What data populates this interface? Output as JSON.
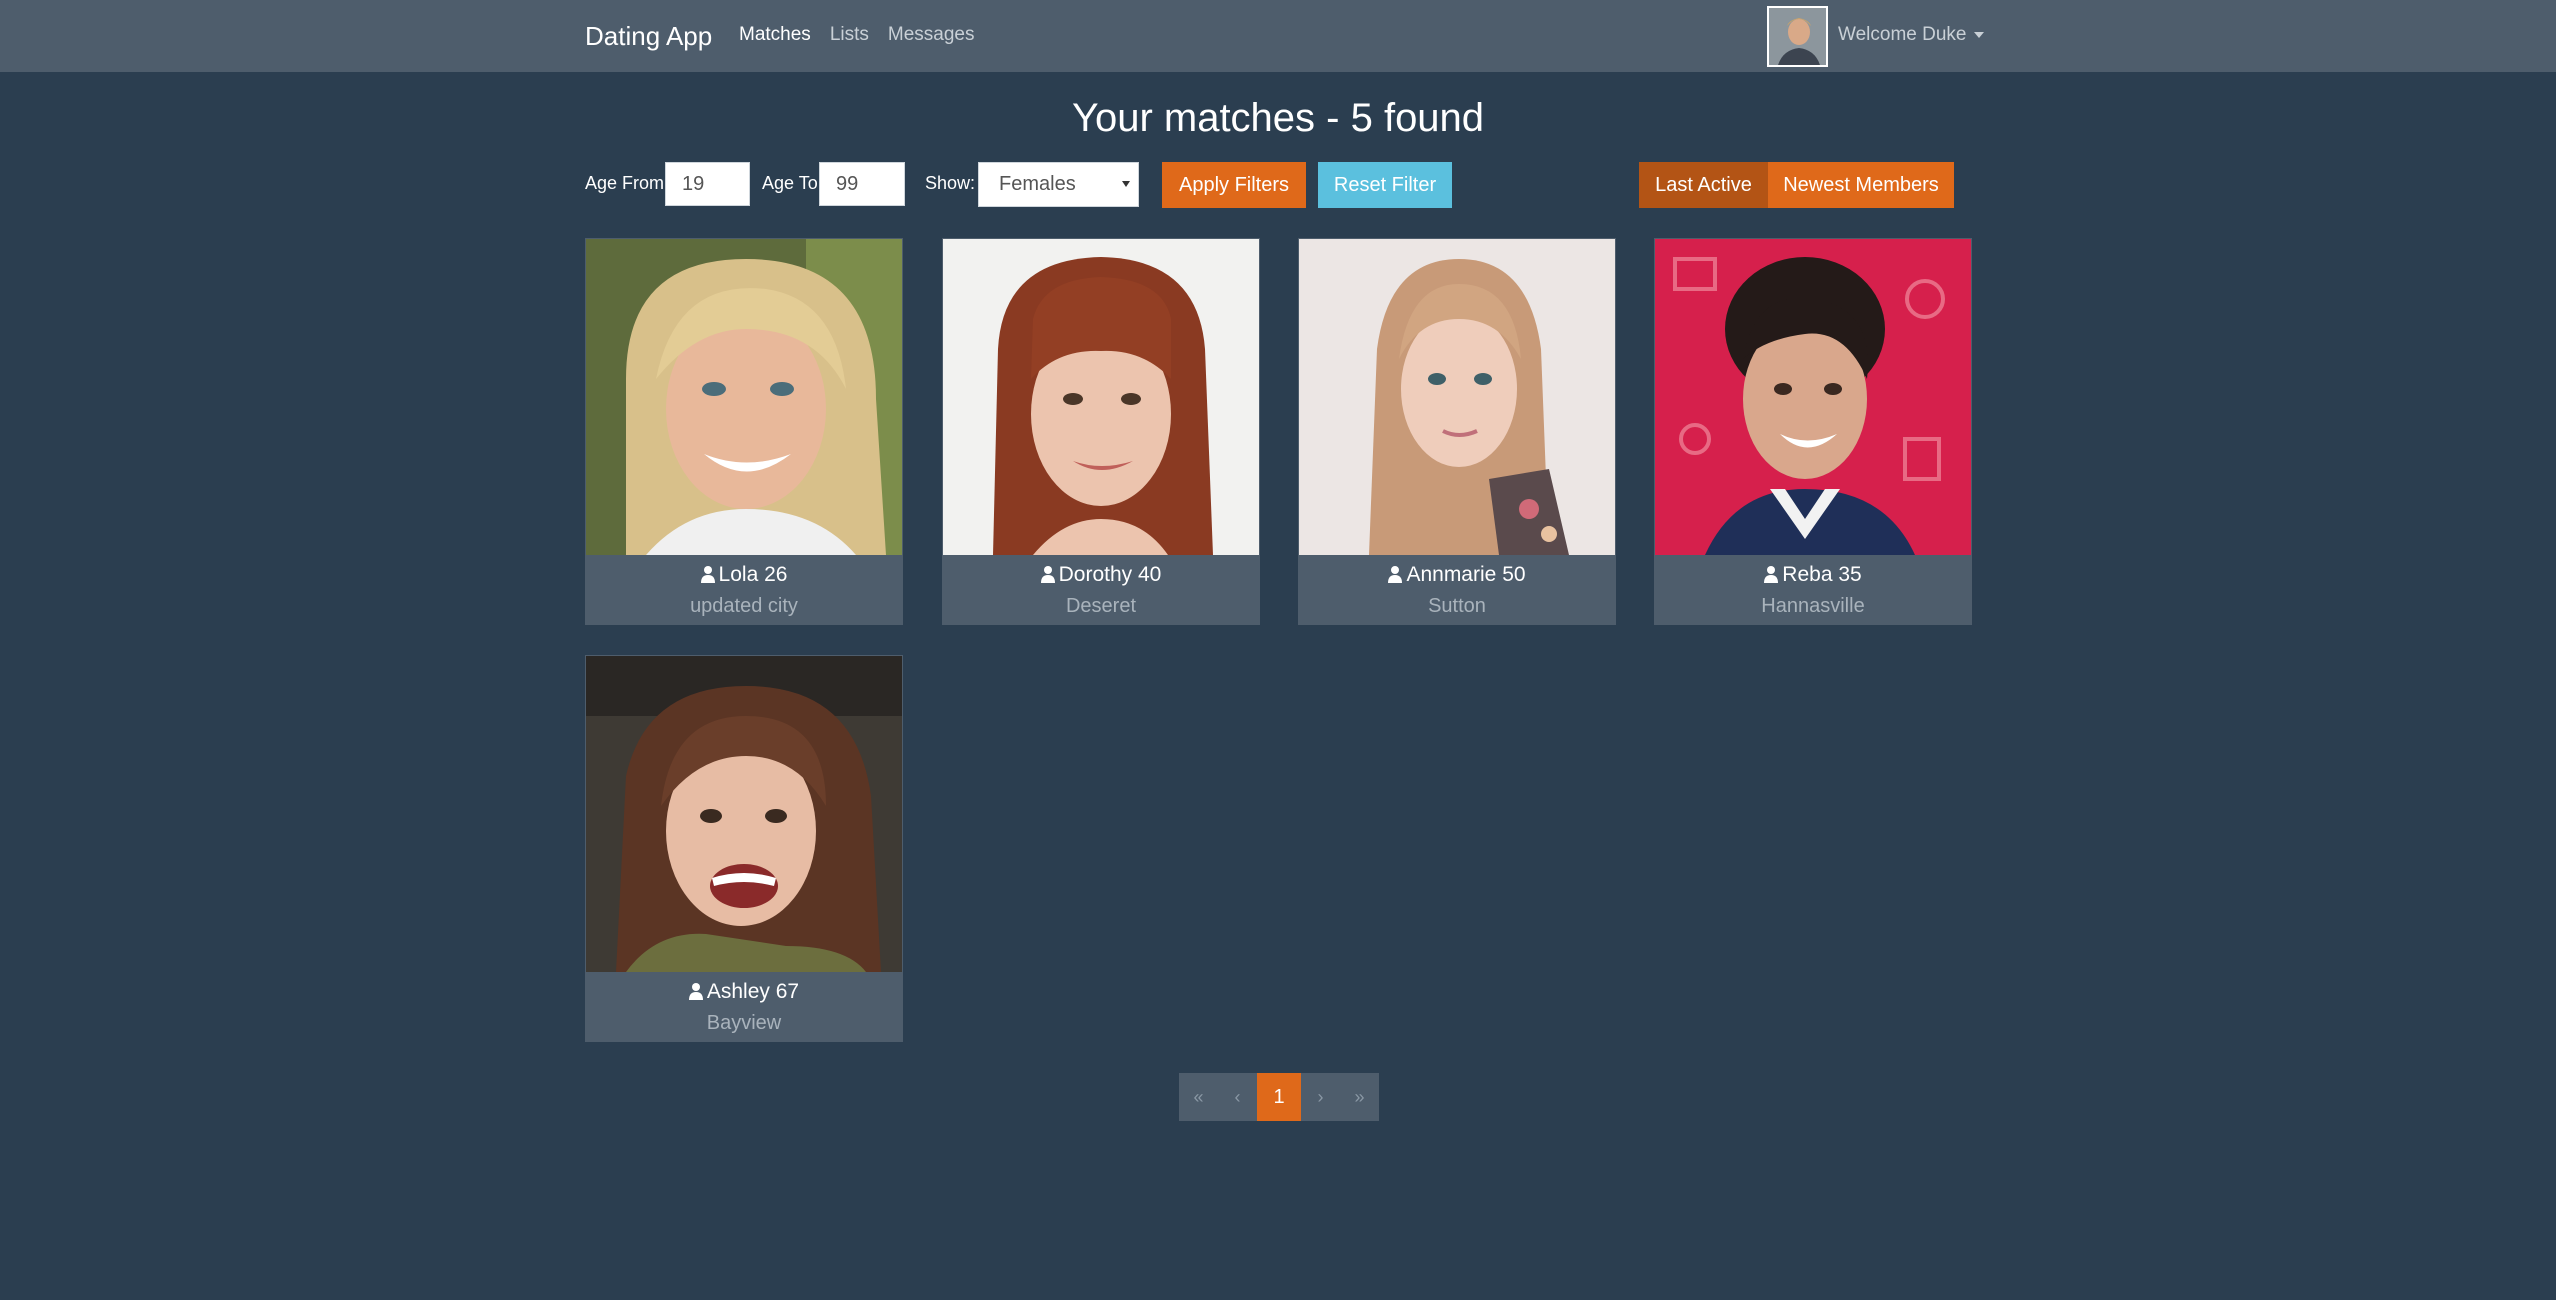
{
  "navbar": {
    "brand": "Dating App",
    "links": [
      {
        "label": "Matches",
        "active": true
      },
      {
        "label": "Lists",
        "active": false
      },
      {
        "label": "Messages",
        "active": false
      }
    ],
    "welcome": "Welcome Duke"
  },
  "page_title": "Your matches - 5 found",
  "filters": {
    "age_from_label": "Age From",
    "age_from_value": "19",
    "age_to_label": "Age To",
    "age_to_value": "99",
    "show_label": "Show:",
    "show_value": "Females",
    "apply_label": "Apply Filters",
    "reset_label": "Reset Filter"
  },
  "sort": {
    "last_active_label": "Last Active",
    "newest_members_label": "Newest Members"
  },
  "members": [
    {
      "name": "Lola",
      "age": "26",
      "city": "updated city"
    },
    {
      "name": "Dorothy",
      "age": "40",
      "city": "Deseret"
    },
    {
      "name": "Annmarie",
      "age": "50",
      "city": "Sutton"
    },
    {
      "name": "Reba",
      "age": "35",
      "city": "Hannasville"
    },
    {
      "name": "Ashley",
      "age": "67",
      "city": "Bayview"
    }
  ],
  "pagination": {
    "first": "«",
    "prev": "‹",
    "current": "1",
    "next": "›",
    "last": "»"
  },
  "colors": {
    "background": "#2b3e50",
    "navbar": "#4e5d6c",
    "accent": "#df691a",
    "info": "#5bc0de"
  }
}
